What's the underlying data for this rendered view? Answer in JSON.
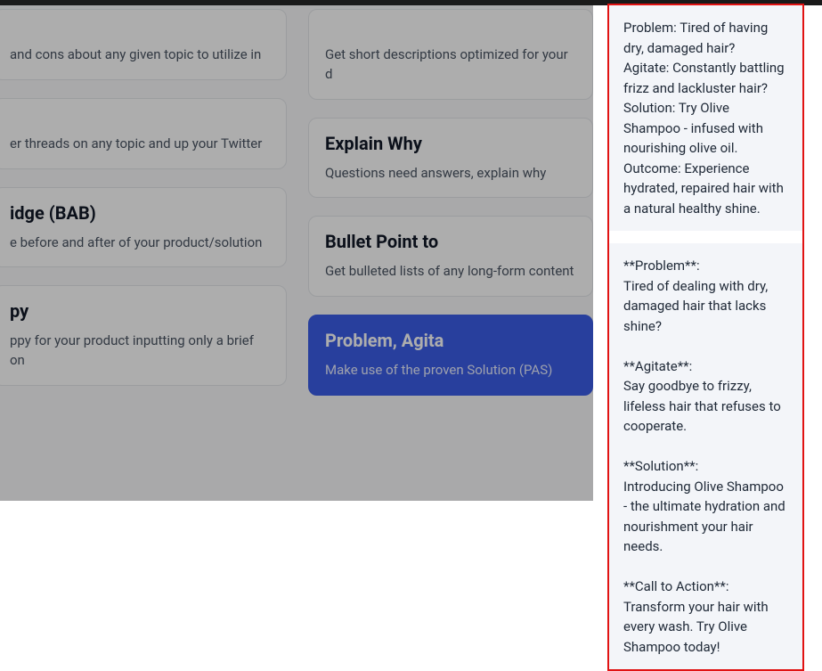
{
  "left_col": {
    "card1": {
      "title": "",
      "desc": "and cons about any given topic to utilize in"
    },
    "card2": {
      "title": "",
      "desc": "er threads on any topic and up your Twitter"
    },
    "card3": {
      "title": "idge (BAB)",
      "desc": "e before and after of your product/solution"
    },
    "card4": {
      "title": "py",
      "desc": "ppy for your product inputting only a brief on"
    }
  },
  "right_col": {
    "card1": {
      "title": "",
      "desc": "Get short descriptions optimized for your d"
    },
    "card2": {
      "title": "Explain Why",
      "desc": "Questions need answers, explain why"
    },
    "card3": {
      "title": "Bullet Point to",
      "desc": "Get bulleted lists of any long-form content"
    },
    "card4": {
      "title": "Problem, Agita",
      "desc": "Make use of the proven Solution (PAS)"
    }
  },
  "output": {
    "msg1": "Problem: Tired of having dry, damaged hair?\nAgitate: Constantly battling frizz and lackluster hair?\nSolution: Try Olive Shampoo - infused with nourishing olive oil.\nOutcome: Experience hydrated, repaired hair with a natural healthy shine.",
    "msg2": "**Problem**:\nTired of dealing with dry, damaged hair that lacks shine?\n\n**Agitate**:\nSay goodbye to frizzy, lifeless hair that refuses to cooperate.\n\n**Solution**:\nIntroducing Olive Shampoo - the ultimate hydration and nourishment your hair needs.\n\n**Call to Action**:\nTransform your hair with every wash. Try Olive Shampoo today!"
  }
}
